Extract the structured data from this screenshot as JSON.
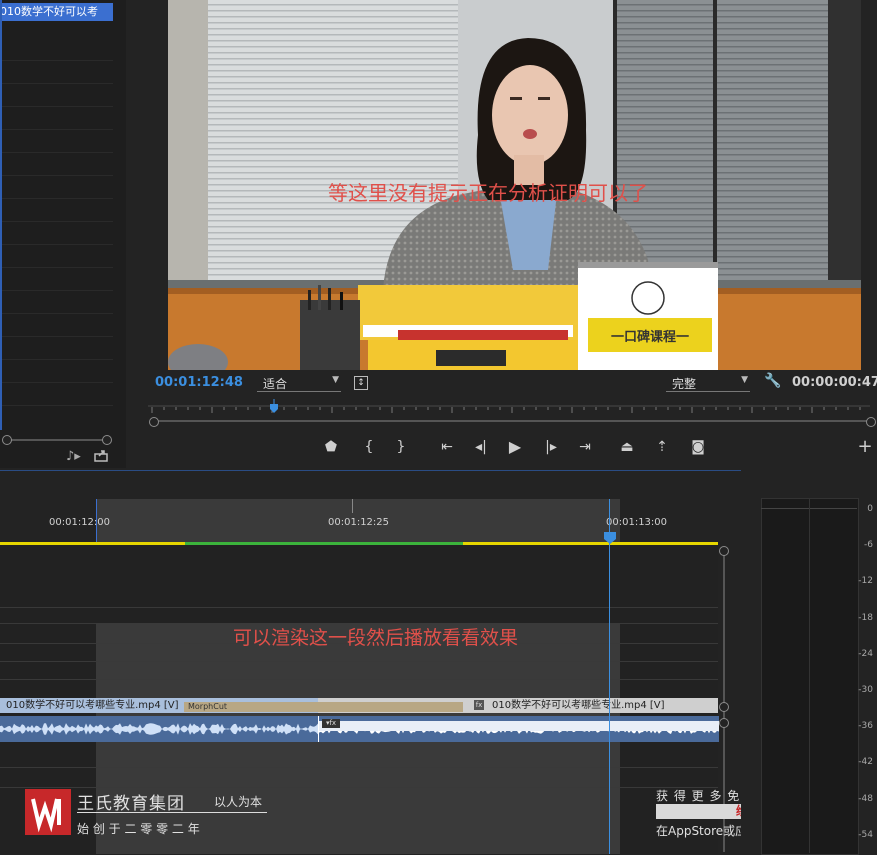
{
  "project": {
    "clip_name": "010数学不好可以考"
  },
  "monitor": {
    "subtitle": "等这里没有提示正在分析证明可以了",
    "sign_text": "一口碑课程一",
    "current_time": "00:01:12:48",
    "fit_label": "适合",
    "quality_label": "完整",
    "duration": "00:00:00:47",
    "playhead_fraction": 0.17
  },
  "timeline": {
    "ruler_labels": [
      "00:01:12:00",
      "00:01:12:25",
      "00:01:13:00"
    ],
    "annotation": "可以渲染这一段然后播放看看效果",
    "clip_left": "010数学不好可以考哪些专业.mp4 [V]",
    "transition": "MorphCut",
    "clip_right": "010数学不好可以考哪些专业.mp4 [V]",
    "fx_label": "fx"
  },
  "meters": {
    "db_labels": [
      "0",
      "-6",
      "-12",
      "-18",
      "-24",
      "-30",
      "-36",
      "-42",
      "-48",
      "-54"
    ]
  },
  "brand": {
    "name": "王氏教育集团",
    "slogan": "以人为本",
    "founded": "始 创 于 二 零 零 二 年",
    "promo_line1": "获 得 更 多 免 费 精 品 教 程",
    "promo_brand": "绘学霸",
    "promo_line2": "在AppStore或应用宝搜索下载"
  },
  "colors": {
    "accent_blue": "#3b8fe0",
    "subtitle_red": "#e0504a",
    "yellow_bar": "#e6d600",
    "green_bar": "#3cb43c"
  },
  "icons": [
    "music-note-icon",
    "export-icon",
    "marker-icon",
    "mark-in-icon",
    "mark-out-icon",
    "go-to-in-icon",
    "step-back-icon",
    "play-icon",
    "step-forward-icon",
    "go-to-out-icon",
    "lift-icon",
    "extract-icon",
    "camera-icon",
    "add-icon",
    "wrench-icon",
    "fx-icon"
  ]
}
